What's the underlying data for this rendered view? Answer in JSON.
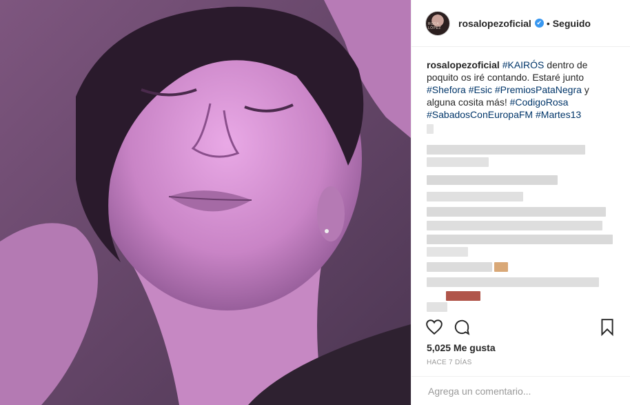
{
  "header": {
    "username": "rosalopezoficial",
    "verified_mark": "✔",
    "separator": "•",
    "follow_status": "Seguido",
    "avatar_text": "ROSA LÓPEZ"
  },
  "caption": {
    "username": "rosalopezoficial",
    "tag_kairos": "#KAIRÓS",
    "text_1": " dentro de poquito os iré contando. Estaré junto ",
    "tag_shefora": "#Shefora",
    "tag_esic": "#Esic",
    "tag_premios": "#PremiosPataNegra",
    "text_2": " y alguna cosita más! ",
    "tag_codigo": "#CodigoRosa",
    "tag_sabados": "#SabadosConEuropaFM",
    "tag_martes": "#Martes13"
  },
  "actions": {
    "like_icon": "heart-icon",
    "comment_icon": "comment-icon",
    "save_icon": "bookmark-icon"
  },
  "likes": "5,025 Me gusta",
  "timestamp": "HACE 7 DÍAS",
  "comment": {
    "placeholder": "Agrega un comentario..."
  },
  "colors": {
    "hashtag": "#003569",
    "verified": "#3897f0",
    "photo_tint": "#b07ab0"
  }
}
